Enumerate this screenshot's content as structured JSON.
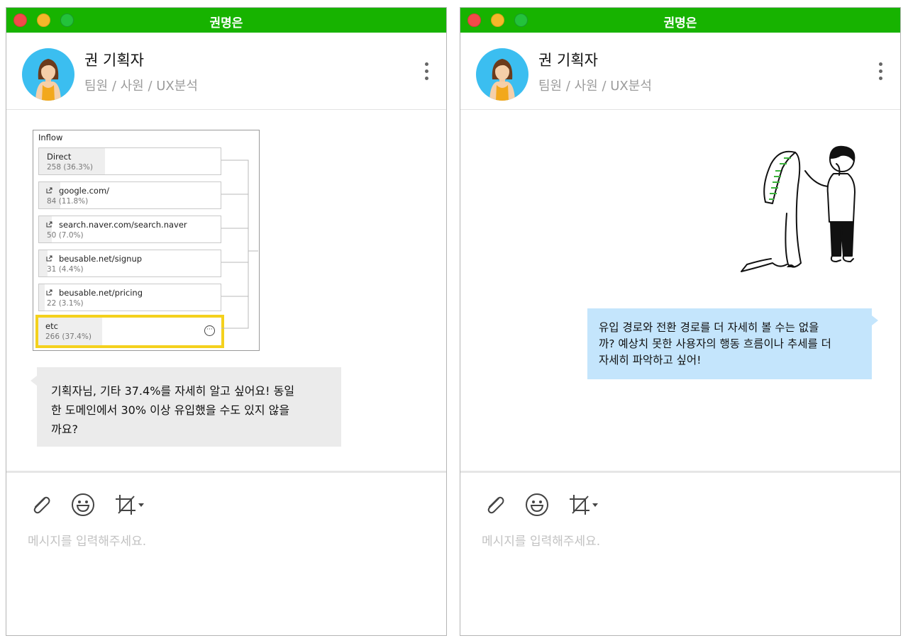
{
  "left_window": {
    "title": "권명은",
    "profile": {
      "name": "권 기획자",
      "role": "팀원 / 사원 / UX분석"
    },
    "inflow_card": {
      "title": "Inflow",
      "rows": [
        {
          "name": "Direct",
          "value": "258 (36.3%)",
          "share": 0.363,
          "external": false
        },
        {
          "name": "google.com/",
          "value": "84 (11.8%)",
          "share": 0.118,
          "external": true
        },
        {
          "name": "search.naver.com/search.naver",
          "value": "50 (7.0%)",
          "share": 0.07,
          "external": true
        },
        {
          "name": "beusable.net/signup",
          "value": "31 (4.4%)",
          "share": 0.044,
          "external": true
        },
        {
          "name": "beusable.net/pricing",
          "value": "22 (3.1%)",
          "share": 0.031,
          "external": true
        }
      ],
      "highlight_row": {
        "name": "etc",
        "value": "266 (37.4%)",
        "share": 0.374,
        "more_glyph": "···"
      }
    },
    "message": {
      "line1": "기획자님, 기타 37.4%를 자세히 알고 싶어요! 동일",
      "line2": "한 도메인에서 30% 이상 유입했을 수도 있지 않을",
      "line3": "까요?"
    },
    "input_placeholder": "메시지를 입력해주세요."
  },
  "right_window": {
    "title": "권명은",
    "profile": {
      "name": "권 기획자",
      "role": "팀원 / 사원 / UX분석"
    },
    "message": {
      "line1": "유입 경로와 전환 경로를 더 자세히 볼 수는 없을",
      "line2": "까? 예상치 못한 사용자의 행동 흐름이나 추세를 더",
      "line3": "자세히 파악하고 싶어!"
    },
    "input_placeholder": "메시지를 입력해주세요."
  },
  "icons": {
    "attach": "paperclip-icon",
    "emoji": "smile-icon",
    "crop": "crop-icon",
    "menu": "more-vertical-icon"
  },
  "colors": {
    "titlebar": "#17b300",
    "bubble_gray": "#ebebeb",
    "bubble_blue": "#c4e5fc",
    "highlight": "#f4d11d",
    "avatar_bg": "#3bbef0"
  }
}
